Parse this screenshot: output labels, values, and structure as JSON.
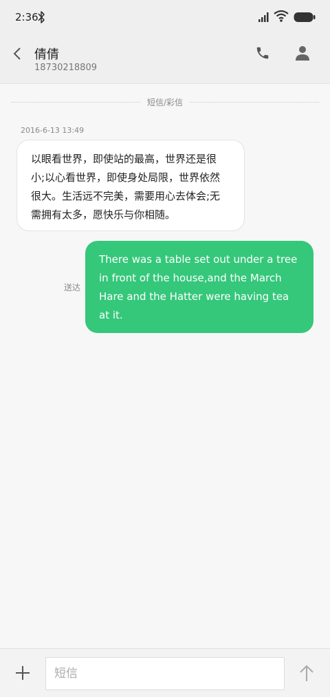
{
  "status_bar": {
    "time": "2:36",
    "icons": [
      "bluetooth-icon",
      "signal-icon",
      "wifi-icon",
      "battery-icon"
    ]
  },
  "header": {
    "contact_name": "倩倩",
    "contact_number": "18730218809",
    "icons": [
      "back-icon",
      "phone-icon",
      "person-icon"
    ]
  },
  "thread": {
    "divider_label": "短信/彩信",
    "messages": [
      {
        "direction": "received",
        "timestamp": "2016-6-13 13:49",
        "text": "以眼看世界，即使站的最高，世界还是很小;以心看世界，即使身处局限，世界依然很大。生活远不完美，需要用心去体会;无需拥有太多，愿快乐与你相随。"
      },
      {
        "direction": "sent",
        "status": "送达",
        "text": "There was a table set out under a tree in front of the house,and the March Hare and the Hatter were having tea at it."
      }
    ]
  },
  "composer": {
    "placeholder": "短信",
    "value": "",
    "icons": [
      "add-icon",
      "send-icon"
    ]
  },
  "colors": {
    "sent_bubble": "#35c77a",
    "received_bubble": "#ffffff",
    "background": "#f7f7f7",
    "header_background": "#efefef"
  }
}
